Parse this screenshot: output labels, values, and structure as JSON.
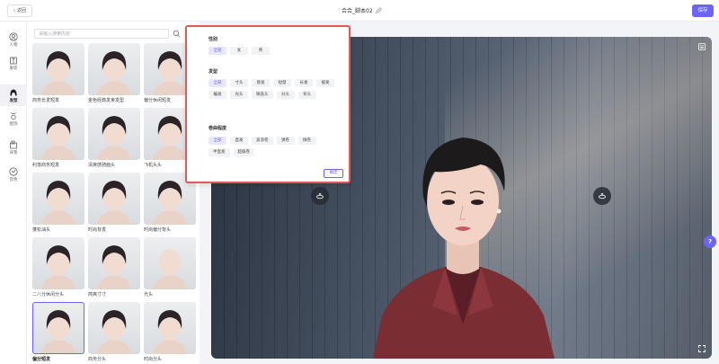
{
  "topbar": {
    "back_label": "返回",
    "title": "合合_脚本02",
    "save_label": "保存"
  },
  "nav": [
    {
      "label": "人物",
      "icon": "person-icon"
    },
    {
      "label": "服装",
      "icon": "clothes-icon"
    },
    {
      "label": "发型",
      "icon": "hair-icon"
    },
    {
      "label": "配饰",
      "icon": "accessory-icon"
    },
    {
      "label": "背景",
      "icon": "background-icon"
    },
    {
      "label": "音色",
      "icon": "voice-icon"
    }
  ],
  "library": {
    "search_placeholder": "请输入搜索内容",
    "items": [
      {
        "label": "商务长发短发"
      },
      {
        "label": "金色经典发束发型"
      },
      {
        "label": "偏分休闲短发"
      },
      {
        "label": "利落商务短发"
      },
      {
        "label": "清爽感骑面头"
      },
      {
        "label": "飞机头头"
      },
      {
        "label": "蓬松油头"
      },
      {
        "label": "时尚背发"
      },
      {
        "label": "时尚偏分背头"
      },
      {
        "label": "二八分休闲分头"
      },
      {
        "label": "简爽寸寸"
      },
      {
        "label": "光头"
      },
      {
        "label": "偏分短发"
      },
      {
        "label": "商务分头"
      },
      {
        "label": "时尚分头"
      }
    ],
    "selected_index": 12
  },
  "filter": {
    "groups": [
      {
        "title": "性别",
        "tags": [
          "全部",
          "女",
          "男"
        ],
        "active": 0
      },
      {
        "title": "发型",
        "tags": [
          "全部",
          "寸头",
          "盘发",
          "短發",
          "长发",
          "披发",
          "编发",
          "光头",
          "锅盖头",
          "分头",
          "背头"
        ],
        "active": 0
      },
      {
        "title": "卷曲程度",
        "tags": [
          "全部",
          "直发",
          "波浪卷",
          "弹卷",
          "微卷",
          "半直发",
          "超级卷"
        ],
        "active": 0
      }
    ],
    "confirm_label": "确定"
  },
  "colors": {
    "accent": "#6c63ff",
    "highlight_border": "#e05a5a"
  }
}
